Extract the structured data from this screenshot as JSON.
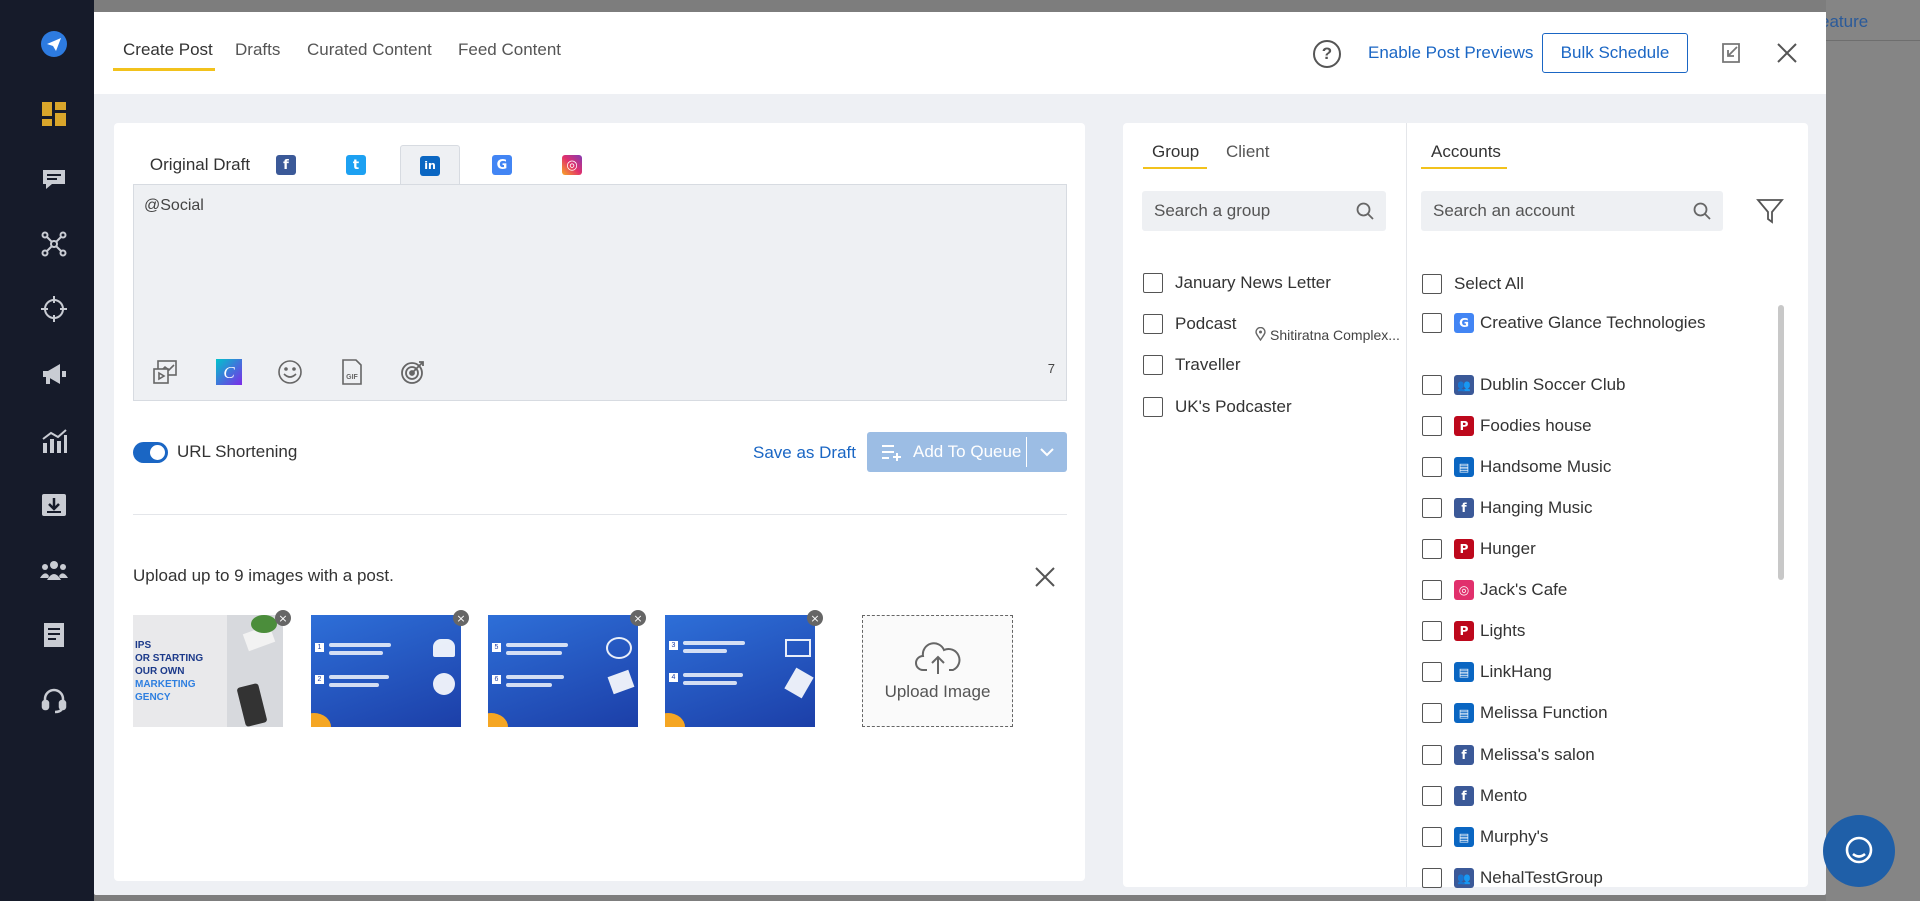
{
  "background": {
    "corner_text": "eature"
  },
  "sidebar": {
    "icons": [
      "paper-plane-icon",
      "dashboard-icon",
      "inbox-icon",
      "network-icon",
      "crosshair-icon",
      "megaphone-icon",
      "analytics-icon",
      "download-icon",
      "team-icon",
      "report-icon",
      "headset-icon"
    ]
  },
  "header": {
    "tabs": [
      "Create Post",
      "Drafts",
      "Curated Content",
      "Feed Content"
    ],
    "active_tab": "Create Post",
    "help_symbol": "?",
    "enable_previews": "Enable Post Previews",
    "bulk_schedule": "Bulk Schedule"
  },
  "editor": {
    "original_draft_tab": "Original Draft",
    "network_tabs": [
      {
        "name": "facebook",
        "glyph": "f",
        "color": "#3b5998"
      },
      {
        "name": "twitter",
        "glyph": "t",
        "color": "#1da1f2"
      },
      {
        "name": "linkedin",
        "glyph": "in",
        "color": "#0a66c2"
      },
      {
        "name": "google-business",
        "glyph": "G",
        "color": "#4285f4"
      },
      {
        "name": "instagram",
        "glyph": "◎",
        "color": "#e1306c"
      }
    ],
    "selected_network": "linkedin",
    "text": "@Social",
    "char_count": "7",
    "url_shortening_label": "URL Shortening",
    "url_shortening_on": true,
    "save_draft": "Save as Draft",
    "add_to_queue": "Add To Queue",
    "upload_hint": "Upload up to 9 images with a post.",
    "upload_label": "Upload Image",
    "thumb_ad_lines": [
      "IPS",
      "OR STARTING",
      "OUR OWN",
      "MARKETING",
      "GENCY"
    ]
  },
  "right_panel": {
    "group_tab": "Group",
    "client_tab": "Client",
    "group_search_placeholder": "Search a group",
    "groups": [
      "January News Letter",
      "Podcast",
      "Traveller",
      "UK's Podcaster"
    ],
    "accounts_tab": "Accounts",
    "account_search_placeholder": "Search an account",
    "select_all": "Select All",
    "accounts": [
      {
        "name": "Creative Glance Technologies",
        "type": "google-business",
        "color": "#4285f4",
        "glyph": "G",
        "sub": "Shitiratna Complex..."
      },
      {
        "name": "Dublin Soccer Club",
        "type": "facebook-group",
        "color": "#3b5998",
        "glyph": "👥"
      },
      {
        "name": "Foodies house",
        "type": "pinterest",
        "color": "#bd081c",
        "glyph": "P"
      },
      {
        "name": "Handsome Music",
        "type": "linkedin-page",
        "color": "#0a66c2",
        "glyph": "▤"
      },
      {
        "name": "Hanging Music",
        "type": "facebook",
        "color": "#3b5998",
        "glyph": "f"
      },
      {
        "name": "Hunger",
        "type": "pinterest",
        "color": "#bd081c",
        "glyph": "P"
      },
      {
        "name": "Jack's Cafe",
        "type": "instagram",
        "color": "#e1306c",
        "glyph": "◎"
      },
      {
        "name": "Lights",
        "type": "pinterest",
        "color": "#bd081c",
        "glyph": "P"
      },
      {
        "name": "LinkHang",
        "type": "linkedin-page",
        "color": "#0a66c2",
        "glyph": "▤"
      },
      {
        "name": "Melissa Function",
        "type": "linkedin-page",
        "color": "#0a66c2",
        "glyph": "▤"
      },
      {
        "name": "Melissa's salon",
        "type": "facebook",
        "color": "#3b5998",
        "glyph": "f"
      },
      {
        "name": "Mento",
        "type": "facebook",
        "color": "#3b5998",
        "glyph": "f"
      },
      {
        "name": "Murphy's",
        "type": "linkedin-page",
        "color": "#0a66c2",
        "glyph": "▤"
      },
      {
        "name": "NehalTestGroup",
        "type": "facebook-group",
        "color": "#3b5998",
        "glyph": "👥"
      }
    ]
  },
  "colors": {
    "accent": "#1a66c4",
    "tab_underline": "#f2c21c",
    "sidebar_bg": "#161b2a"
  }
}
